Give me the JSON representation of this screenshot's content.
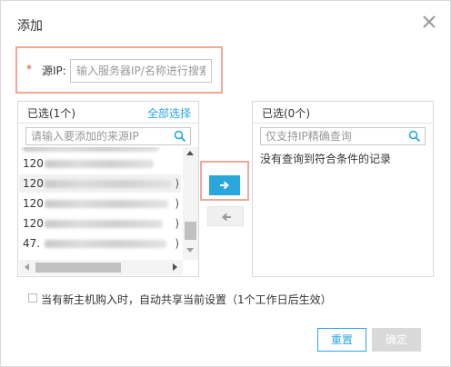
{
  "dialog": {
    "title": "添加",
    "close_icon": "close-icon"
  },
  "source": {
    "required_mark": "*",
    "label": "源IP:",
    "placeholder": "输入服务器IP/名称进行搜索",
    "value": ""
  },
  "left_panel": {
    "count_label": "已选(1个)",
    "select_all": "全部选择",
    "search_placeholder": "请输入要添加的来源IP",
    "items": [
      {
        "ip": "120",
        "paren": ")"
      },
      {
        "ip": "120",
        "paren": ")"
      },
      {
        "ip": "120",
        "paren": ")"
      },
      {
        "ip": "120",
        "paren": ")"
      },
      {
        "ip": "47.",
        "paren": ")"
      }
    ]
  },
  "right_panel": {
    "count_label": "已选(0个)",
    "search_placeholder": "仅支持IP精确查询",
    "empty_text": "没有查询到符合条件的记录"
  },
  "transfer": {
    "move_right_icon": "arrow-right-icon",
    "move_left_icon": "arrow-left-icon"
  },
  "share": {
    "label": "当有新主机购入时，自动共享当前设置（1个工作日后生效）",
    "checked": false
  },
  "footer": {
    "reset": "重置",
    "confirm": "确定"
  },
  "colors": {
    "accent": "#29a7dd",
    "highlight_border": "#f0a899",
    "required": "#e0492d",
    "disabled": "#d9d9d9"
  }
}
